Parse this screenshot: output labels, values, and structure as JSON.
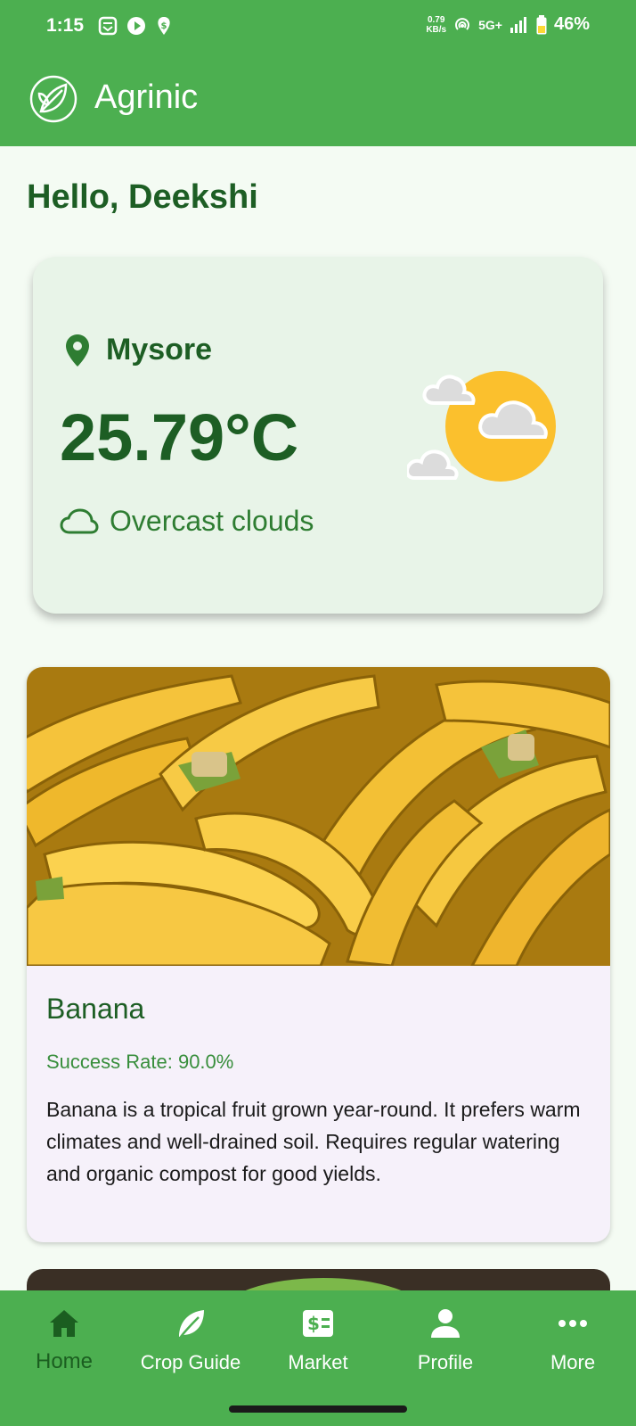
{
  "status_bar": {
    "time": "1:15",
    "net_speed_value": "0.79",
    "net_speed_unit": "KB/s",
    "network": "5G+",
    "battery": "46%"
  },
  "app": {
    "title": "Agrinic"
  },
  "greeting": "Hello, Deekshi",
  "weather": {
    "location": "Mysore",
    "temperature": "25.79°C",
    "condition": "Overcast clouds"
  },
  "crop": {
    "name": "Banana",
    "success_rate": "Success Rate: 90.0%",
    "description": "Banana is a tropical fruit grown year-round. It prefers warm climates and well-drained soil. Requires regular watering and organic compost for good yields."
  },
  "nav": {
    "items": [
      {
        "label": "Home",
        "icon": "home-icon",
        "active": true
      },
      {
        "label": "Crop Guide",
        "icon": "leaf-icon",
        "active": false
      },
      {
        "label": "Market",
        "icon": "money-icon",
        "active": false
      },
      {
        "label": "Profile",
        "icon": "person-icon",
        "active": false
      },
      {
        "label": "More",
        "icon": "more-icon",
        "active": false
      }
    ]
  },
  "colors": {
    "primary": "#4caf50",
    "dark_green": "#1d5e24",
    "card_bg": "#e8f4e8",
    "sun": "#fbc02d"
  }
}
